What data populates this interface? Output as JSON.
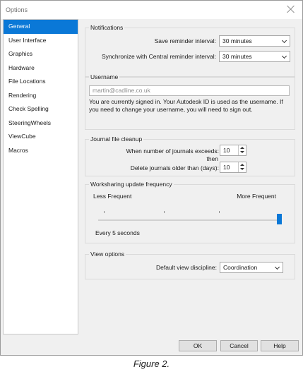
{
  "window": {
    "title": "Options"
  },
  "sidebar": {
    "items": [
      {
        "label": "General"
      },
      {
        "label": "User Interface"
      },
      {
        "label": "Graphics"
      },
      {
        "label": "Hardware"
      },
      {
        "label": "File Locations"
      },
      {
        "label": "Rendering"
      },
      {
        "label": "Check Spelling"
      },
      {
        "label": "SteeringWheels"
      },
      {
        "label": "ViewCube"
      },
      {
        "label": "Macros"
      }
    ],
    "selected": "General"
  },
  "notifications": {
    "legend": "Notifications",
    "save_label": "Save reminder interval:",
    "save_value": "30 minutes",
    "sync_label": "Synchronize with Central reminder interval:",
    "sync_value": "30 minutes"
  },
  "username": {
    "legend": "Username",
    "value": "martin@cadline.co.uk",
    "description": "You are currently signed in. Your Autodesk ID is used as the username. If you need to change your username, you will need to sign out."
  },
  "journal": {
    "legend": "Journal file cleanup",
    "exceeds_label": "When number of journals exceeds:",
    "exceeds_value": "10",
    "then_label": "then",
    "older_label": "Delete journals older than (days):",
    "older_value": "10"
  },
  "worksharing": {
    "legend": "Worksharing update frequency",
    "less_label": "Less Frequent",
    "more_label": "More Frequent",
    "status": "Every 5 seconds",
    "slider_fraction": 1.0
  },
  "view_options": {
    "legend": "View options",
    "discipline_label": "Default view discipline:",
    "discipline_value": "Coordination"
  },
  "buttons": {
    "ok": "OK",
    "cancel": "Cancel",
    "help": "Help"
  },
  "caption": "Figure 2.",
  "colors": {
    "accent": "#0a78d7",
    "panel": "#f0f0f0"
  }
}
